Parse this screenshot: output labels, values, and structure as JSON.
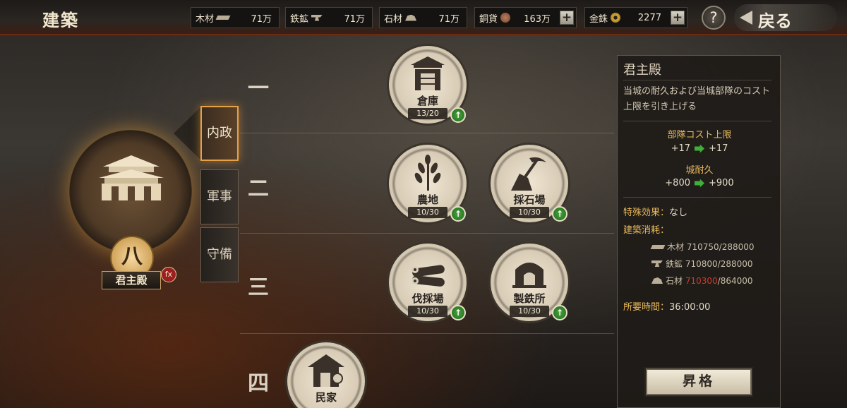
{
  "header": {
    "title": "建築",
    "resources": [
      {
        "label": "木材",
        "icon": "wood-icon",
        "value": "71万"
      },
      {
        "label": "鉄鉱",
        "icon": "iron-icon",
        "value": "71万"
      },
      {
        "label": "石材",
        "icon": "stone-icon",
        "value": "71万"
      },
      {
        "label": "銅貨",
        "icon": "copper-coin-icon",
        "value": "163万"
      },
      {
        "label": "金銖",
        "icon": "gold-coin-icon",
        "value": "2277"
      }
    ],
    "help_label": "?",
    "back_label": "戻る"
  },
  "hall": {
    "name": "君主殿",
    "level": "八",
    "badge": "fx"
  },
  "categories": [
    {
      "label": "内政",
      "active": true
    },
    {
      "label": "軍事",
      "active": false
    },
    {
      "label": "守備",
      "active": false
    }
  ],
  "tiers": [
    "一",
    "二",
    "三",
    "四"
  ],
  "buildings": [
    {
      "name": "倉庫",
      "level": "13/20"
    },
    {
      "name": "農地",
      "level": "10/30"
    },
    {
      "name": "採石場",
      "level": "10/30"
    },
    {
      "name": "伐採場",
      "level": "10/30"
    },
    {
      "name": "製鉄所",
      "level": "10/30"
    },
    {
      "name": "民家",
      "level": ""
    }
  ],
  "upgrade_glyph": "↑",
  "info": {
    "title": "君主殿",
    "description": "当城の耐久および当城部隊のコスト上限を引き上げる",
    "stat1_label": "部隊コスト上限",
    "stat1_from": "+17",
    "stat1_to": "+17",
    "stat2_label": "城耐久",
    "stat2_from": "+800",
    "stat2_to": "+900",
    "special_label": "特殊効果：",
    "special_value": "なし",
    "cost_label": "建築消耗：",
    "costs": [
      {
        "label": "木材",
        "have": "710750",
        "need": "/288000",
        "short": false
      },
      {
        "label": "鉄鉱",
        "have": "710800",
        "need": "/288000",
        "short": false
      },
      {
        "label": "石材",
        "have": "710300",
        "need": "/864000",
        "short": true
      }
    ],
    "time_label": "所要時間：",
    "time_value": "36:00:00",
    "upgrade_label": "昇格"
  },
  "colors": {
    "accent": "#e9b85a",
    "upgrade_green": "#3fae3a",
    "insufficient_red": "#d0392e"
  }
}
